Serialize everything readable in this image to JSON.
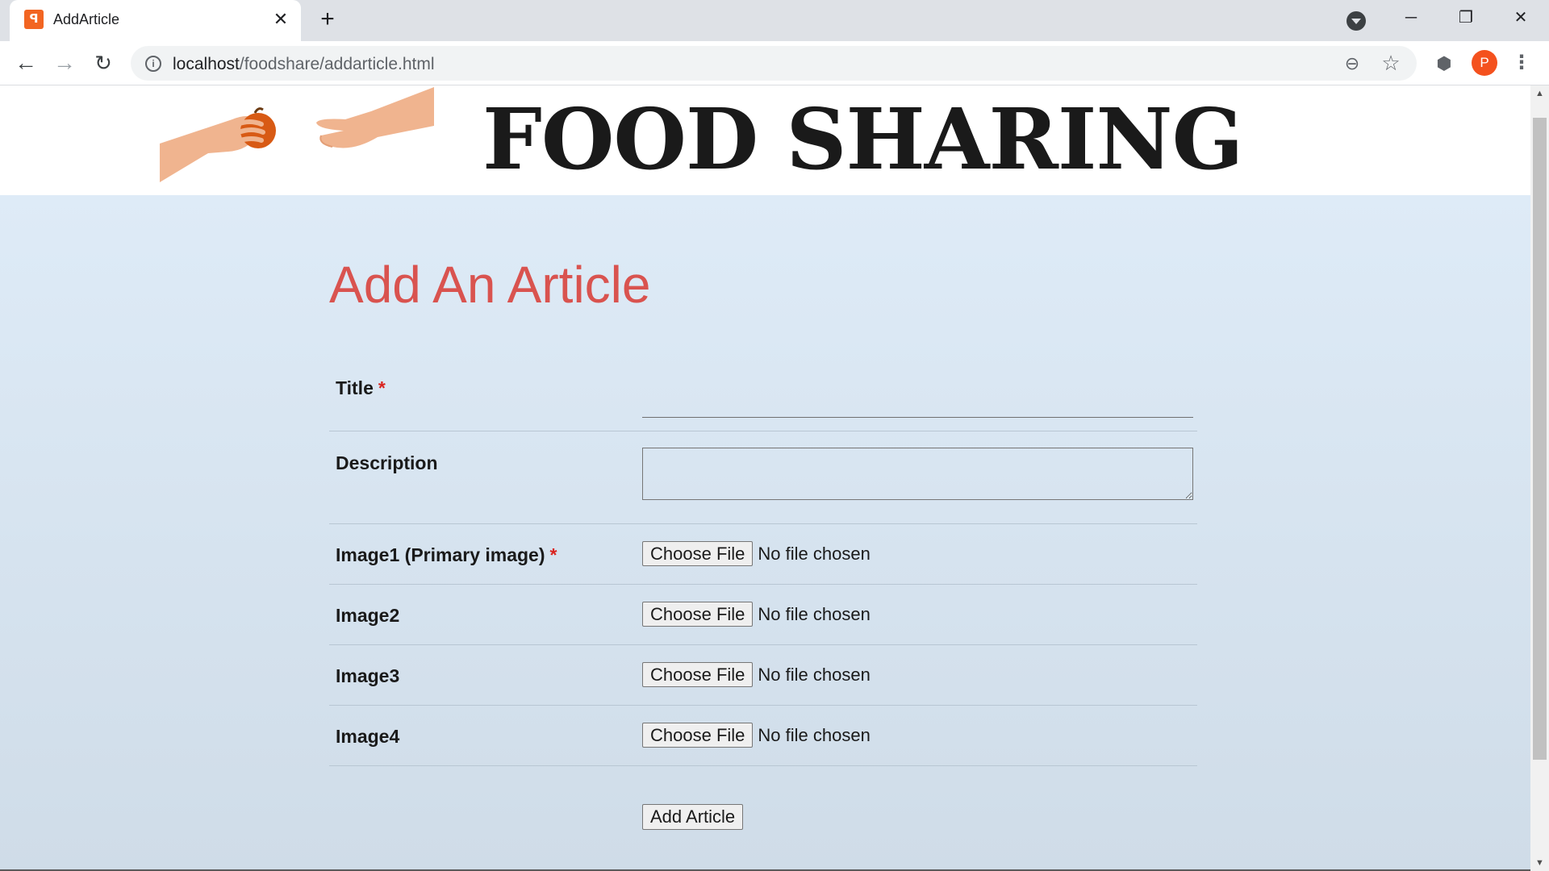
{
  "browser": {
    "tab_title": "AddArticle",
    "tab_favicon_text": "ꟼ",
    "url_host": "localhost",
    "url_path": "/foodshare/addarticle.html",
    "profile_initial": "P",
    "icons": {
      "close_tab": "✕",
      "new_tab": "+",
      "back": "←",
      "forward": "→",
      "reload": "↻",
      "info": "i",
      "zoom": "⊖",
      "star": "☆",
      "extensions": "⬢",
      "menu": "⋮",
      "minimize": "─",
      "maximize": "❐",
      "window_close": "✕",
      "scroll_up": "▲",
      "scroll_down": "▼"
    }
  },
  "site": {
    "title": "FOOD SHARING"
  },
  "page": {
    "heading": "Add An Article",
    "required_marker": "*",
    "fields": {
      "title_label": "Title",
      "description_label": "Description",
      "image1_label": "Image1 (Primary image)",
      "image2_label": "Image2",
      "image3_label": "Image3",
      "image4_label": "Image4"
    },
    "file_button_label": "Choose File",
    "file_status": "No file chosen",
    "submit_label": "Add Article"
  },
  "colors": {
    "heading": "#d9534f",
    "required": "#d9231f",
    "background_top": "#deebf7",
    "background_bottom": "#cfdce8",
    "avatar": "#f4511e",
    "favicon": "#f26522"
  }
}
